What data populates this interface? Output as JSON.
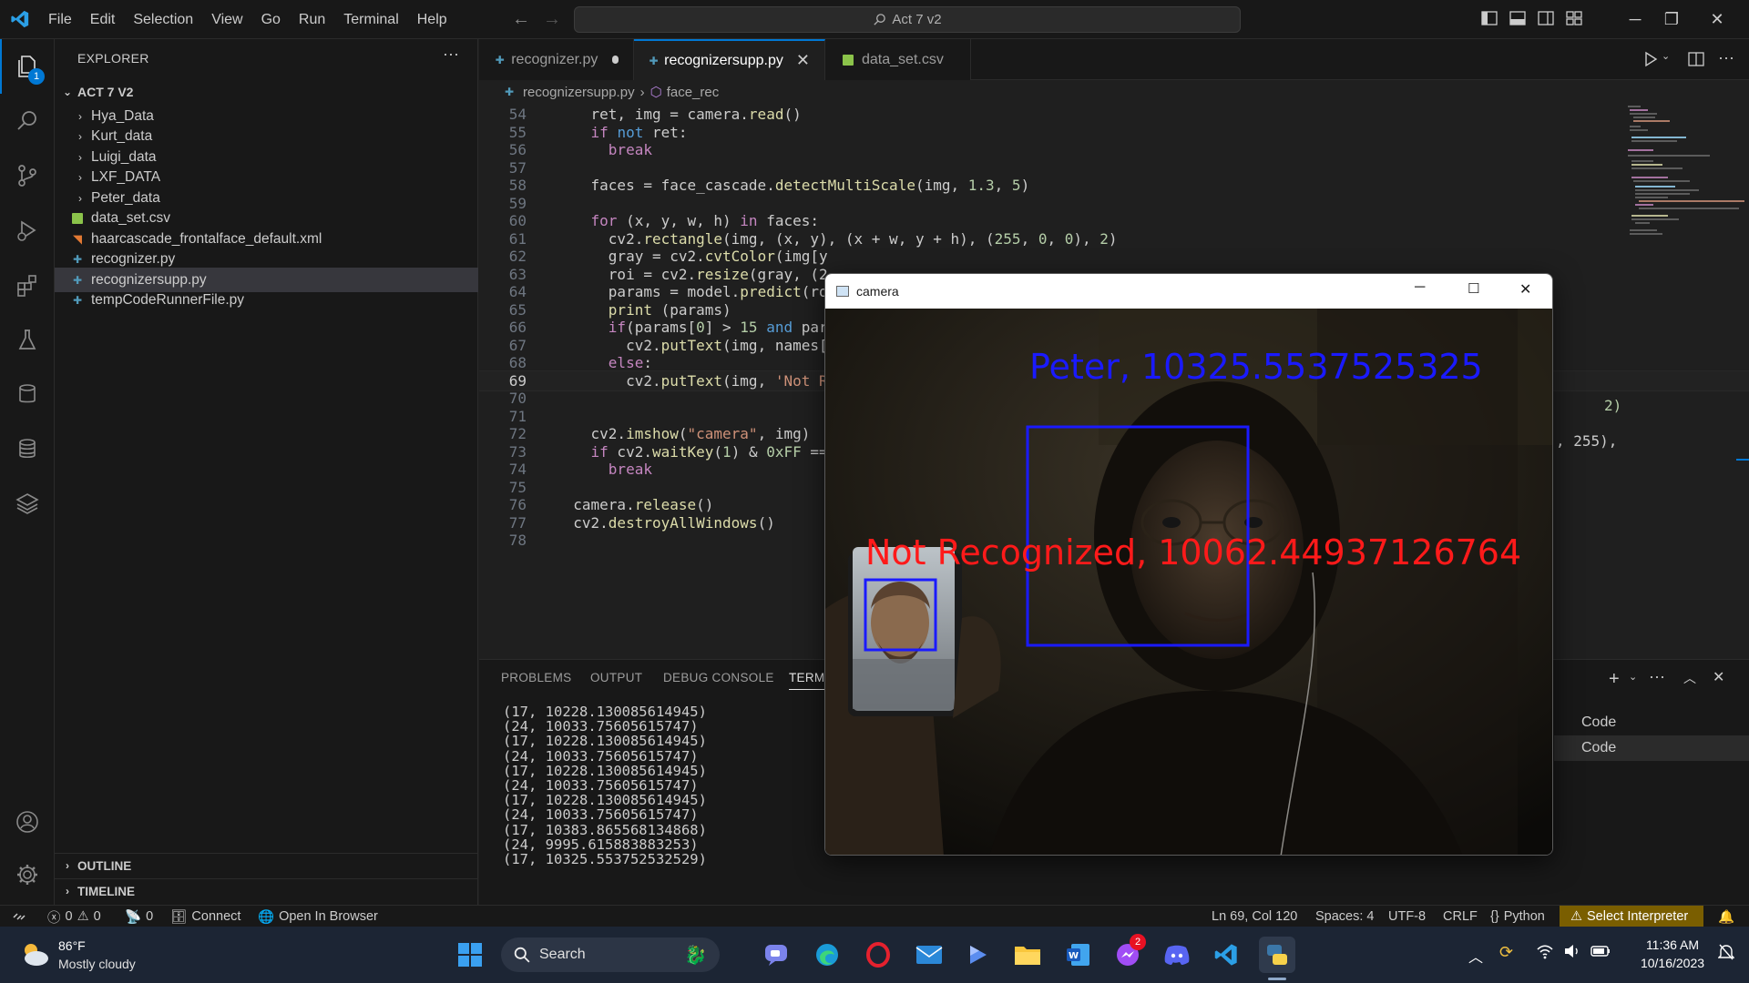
{
  "titlebar": {
    "menu": [
      "File",
      "Edit",
      "Selection",
      "View",
      "Go",
      "Run",
      "Terminal",
      "Help"
    ],
    "search_text": "Act 7 v2"
  },
  "activity": {
    "explorer_badge": "1"
  },
  "sidebar": {
    "title": "EXPLORER",
    "folder": "ACT 7 V2",
    "items": [
      {
        "label": "Hya_Data",
        "type": "folder"
      },
      {
        "label": "Kurt_data",
        "type": "folder"
      },
      {
        "label": "Luigi_data",
        "type": "folder"
      },
      {
        "label": "LXF_DATA",
        "type": "folder"
      },
      {
        "label": "Peter_data",
        "type": "folder"
      },
      {
        "label": "data_set.csv",
        "type": "csv"
      },
      {
        "label": "haarcascade_frontalface_default.xml",
        "type": "xml"
      },
      {
        "label": "recognizer.py",
        "type": "py"
      },
      {
        "label": "recognizersupp.py",
        "type": "py",
        "selected": true
      },
      {
        "label": "tempCodeRunnerFile.py",
        "type": "py"
      }
    ],
    "outline": "OUTLINE",
    "timeline": "TIMELINE"
  },
  "tabs": [
    {
      "label": "recognizer.py",
      "state": "modified"
    },
    {
      "label": "recognizersupp.py",
      "state": "active"
    },
    {
      "label": "data_set.csv",
      "state": "normal"
    }
  ],
  "breadcrumb": {
    "file": "recognizersupp.py",
    "symbol": "face_rec"
  },
  "code": {
    "line_numbers": [
      "54",
      "55",
      "56",
      "57",
      "58",
      "59",
      "60",
      "61",
      "62",
      "63",
      "64",
      "65",
      "66",
      "67",
      "68",
      "69",
      "70",
      "71",
      "72",
      "73",
      "74",
      "75",
      "76",
      "77",
      "78"
    ],
    "current_line": "69",
    "right_tail_67": "2)",
    "right_tail_69": ", 255),"
  },
  "panel": {
    "tabs": [
      "PROBLEMS",
      "OUTPUT",
      "DEBUG CONSOLE",
      "TERMI"
    ],
    "terminal_lines": [
      "(17, 10228.130085614945)",
      "(24, 10033.75605615747)",
      "(17, 10228.130085614945)",
      "(24, 10033.75605615747)",
      "(17, 10228.130085614945)",
      "(24, 10033.75605615747)",
      "(17, 10228.130085614945)",
      "(24, 10033.75605615747)",
      "(17, 10383.865568134868)",
      "(24, 9995.615883883253)",
      "(17, 10325.553752532529)"
    ],
    "terminal_list": [
      "Code",
      "Code"
    ]
  },
  "camera": {
    "title": "camera",
    "label_recognized": "Peter, 10325.5537525325",
    "label_unrecognized": "Not Recognized, 10062.44937126764",
    "colors": {
      "recognized": "#1a1aff",
      "unrecognized": "#ff1a1a"
    }
  },
  "statusbar": {
    "errors": "0",
    "warnings": "0",
    "ports": "0",
    "connect": "Connect",
    "open_browser": "Open In Browser",
    "position": "Ln 69, Col 120",
    "spaces": "Spaces: 4",
    "encoding": "UTF-8",
    "eol": "CRLF",
    "language": "Python",
    "interpreter": "Select Interpreter"
  },
  "taskbar": {
    "weather_temp": "86°F",
    "weather_desc": "Mostly cloudy",
    "search": "Search",
    "messenger_badge": "2",
    "time": "11:36 AM",
    "date": "10/16/2023"
  }
}
